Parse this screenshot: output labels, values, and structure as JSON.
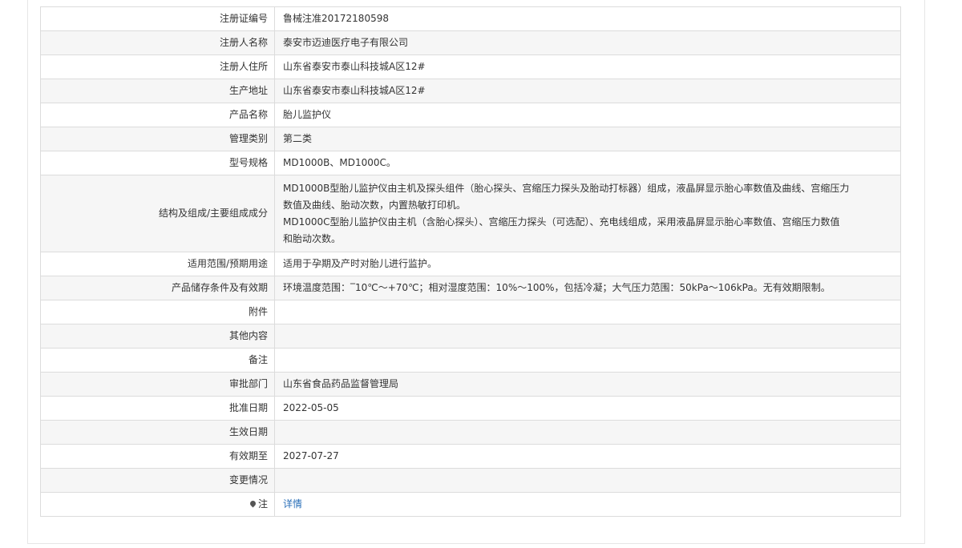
{
  "rows": [
    {
      "label": "注册证编号",
      "value": "鲁械注准20172180598"
    },
    {
      "label": "注册人名称",
      "value": "泰安市迈迪医疗电子有限公司"
    },
    {
      "label": "注册人住所",
      "value": "山东省泰安市泰山科技城A区12#"
    },
    {
      "label": "生产地址",
      "value": "山东省泰安市泰山科技城A区12#"
    },
    {
      "label": "产品名称",
      "value": "胎儿监护仪"
    },
    {
      "label": "管理类别",
      "value": "第二类"
    },
    {
      "label": "型号规格",
      "value": "MD1000B、MD1000C。"
    },
    {
      "label": "结构及组成/主要组成成分",
      "lines": [
        "MD1000B型胎儿监护仪由主机及探头组件（胎心探头、宫缩压力探头及胎动打标器）组成，液晶屏显示胎心率数值及曲线、宫缩压力",
        "数值及曲线、胎动次数，内置热敏打印机。",
        "MD1000C型胎儿监护仪由主机（含胎心探头）、宫缩压力探头（可选配）、充电线组成，采用液晶屏显示胎心率数值、宫缩压力数值",
        "和胎动次数。"
      ]
    },
    {
      "label": "适用范围/预期用途",
      "value": "适用于孕期及产时对胎儿进行监护。"
    },
    {
      "label": "产品储存条件及有效期",
      "value": "环境温度范围：‾10℃～+70℃；相对湿度范围：10%～100%，包括冷凝；大气压力范围：50kPa～106kPa。无有效期限制。"
    },
    {
      "label": "附件",
      "value": ""
    },
    {
      "label": "其他内容",
      "value": ""
    },
    {
      "label": "备注",
      "value": ""
    },
    {
      "label": "审批部门",
      "value": "山东省食品药品监督管理局"
    },
    {
      "label": "批准日期",
      "value": "2022-05-05"
    },
    {
      "label": "生效日期",
      "value": ""
    },
    {
      "label": "有效期至",
      "value": "2027-07-27"
    },
    {
      "label": "变更情况",
      "value": ""
    },
    {
      "label": "注",
      "value": "详情",
      "icon": "pin-icon"
    }
  ]
}
